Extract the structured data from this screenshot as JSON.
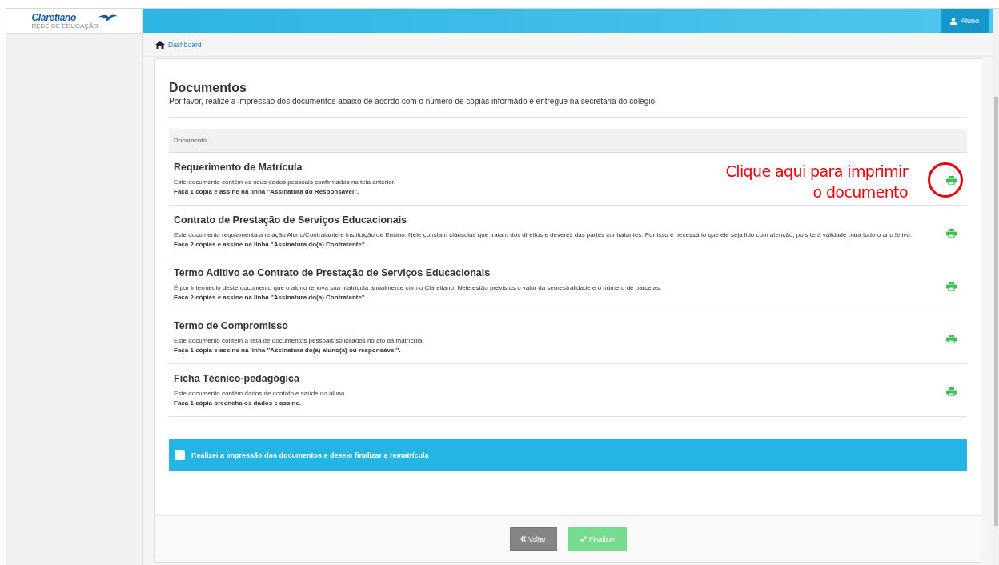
{
  "logo": {
    "name": "Claretiano",
    "tagline": "REDE DE EDUCAÇÃO"
  },
  "header": {
    "user_button": "Aluno"
  },
  "breadcrumb": [
    "Dashboard"
  ],
  "page": {
    "title": "Documentos",
    "subtitle": "Por favor, realize a impressão dos documentos abaixo de acordo com o número de cópias informado e entregue na secretaria do colégio."
  },
  "table": {
    "columns": [
      "Documento"
    ],
    "rows": [
      {
        "title": "Requerimento de Matrícula",
        "description": "Este documento contêm os seus dados pessoais confirmados na tela anterior.",
        "instruction": "Faça 1 cópia e assine na linha \"Assinatura do Responsável\".",
        "highlighted": true
      },
      {
        "title": "Contrato de Prestação de Serviços Educacionais",
        "description": "Este documento regulamenta a relação Aluno/Contratante e Instituição de Ensino. Nele constam cláusulas que tratam dos direitos e deveres das partes contratantes. Por isso é necessário que ele seja lido com atenção, pois terá validade para todo o ano letivo.",
        "instruction": "Faça 2 cópias e assine na linha \"Assinatura do(a) Contratante\".",
        "highlighted": false
      },
      {
        "title": "Termo Aditivo ao Contrato de Prestação de Serviços Educacionais",
        "description": "É por intermédio deste documento que o aluno renova sua matrícula anualmente com o Claretiano. Nele estão previstos o valor da semestralidade e o número de parcelas.",
        "instruction": "Faça 2 cópias e assine na linha \"Assinatura do(a) Contratante\".",
        "highlighted": false
      },
      {
        "title": "Termo de Compromisso",
        "description": "Este documento contém a lista de documentos pessoais solicitados no ato da matrícula.",
        "instruction": "Faça 1 cópia e assine na linha \"Assinatura do(a) aluno(a) ou responsável\".",
        "highlighted": false
      },
      {
        "title": "Ficha Técnico-pedagógica",
        "description": "Este documento contém dados de contato e saúde do aluno.",
        "instruction": "Faça 1 cópia preencha os dados e assine.",
        "highlighted": false
      }
    ]
  },
  "annotation": {
    "lines": [
      "Clique aqui para imprimir",
      "o documento"
    ]
  },
  "confirm": {
    "label": "Realizei a impressão dos documentos e desejo finalizar a rematrícula",
    "checked": false
  },
  "buttons": [
    {
      "kind": "back",
      "label": "Voltar",
      "disabled": false
    },
    {
      "kind": "finish",
      "label": "Finalizar",
      "disabled": true
    }
  ]
}
